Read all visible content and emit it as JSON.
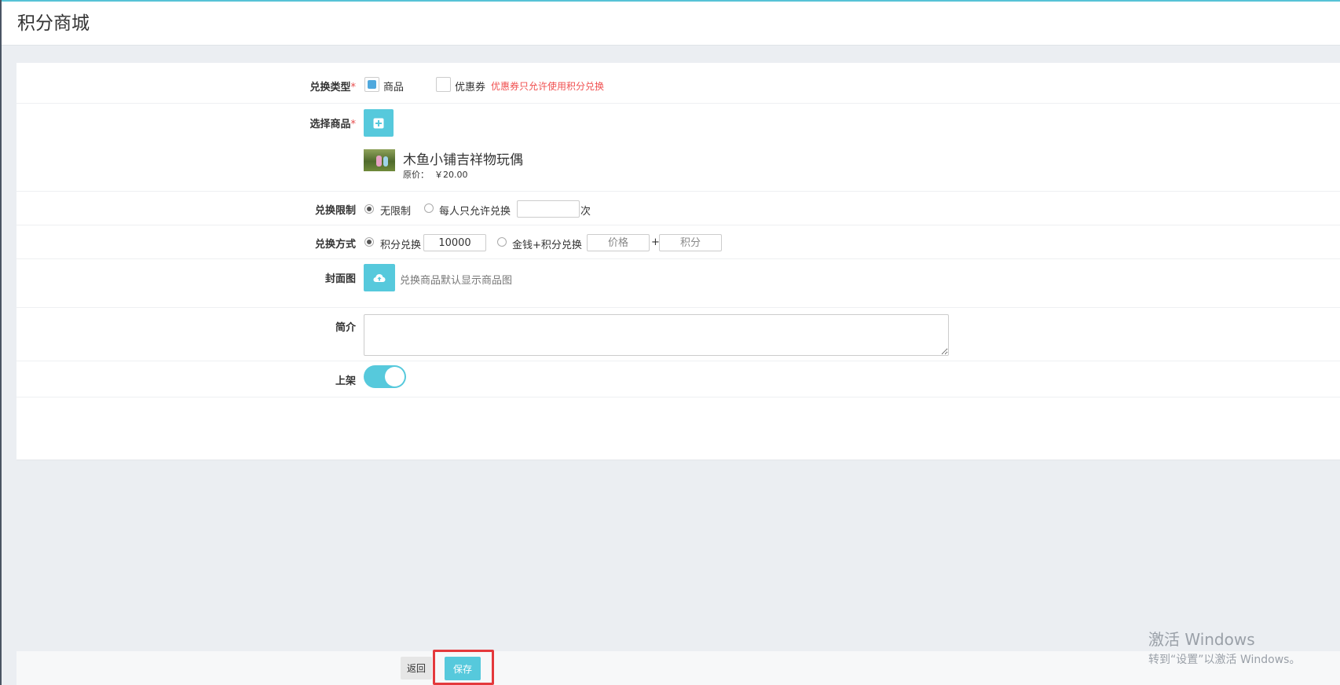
{
  "page_title": "积分商城",
  "form": {
    "exchange_type": {
      "label": "兑换类型",
      "required_mark": "*",
      "options": [
        {
          "label": "商品",
          "checked": true
        },
        {
          "label": "优惠券",
          "checked": false
        }
      ],
      "hint": "优惠券只允许使用积分兑换"
    },
    "select_goods": {
      "label": "选择商品",
      "required_mark": "*",
      "add_icon": "plus-square-icon",
      "product": {
        "name": "木鱼小铺吉祥物玩偶",
        "price_label": "原价：",
        "price": "￥20.00"
      }
    },
    "exchange_limit": {
      "label": "兑换限制",
      "options": [
        {
          "label": "无限制",
          "selected": true
        },
        {
          "label": "每人只允许兑换",
          "selected": false
        }
      ],
      "limit_value": "",
      "unit": "次"
    },
    "exchange_method": {
      "label": "兑换方式",
      "options": [
        {
          "label": "积分兑换",
          "selected": true
        },
        {
          "label": "金钱+积分兑换",
          "selected": false
        }
      ],
      "points_value": "10000",
      "price_placeholder": "价格",
      "plus": "+",
      "points_placeholder": "积分"
    },
    "cover": {
      "label": "封面图",
      "upload_icon": "cloud-upload-icon",
      "hint": "兑换商品默认显示商品图"
    },
    "intro": {
      "label": "简介",
      "value": ""
    },
    "listed": {
      "label": "上架",
      "on": true
    }
  },
  "footer": {
    "back_label": "返回",
    "save_label": "保存"
  },
  "watermark": {
    "line1": "激活 Windows",
    "line2": "转到“设置”以激活 Windows。"
  },
  "colors": {
    "accent": "#56c9dc",
    "required": "#e64c4c",
    "hint": "#f05050",
    "highlight": "#e4393c"
  }
}
